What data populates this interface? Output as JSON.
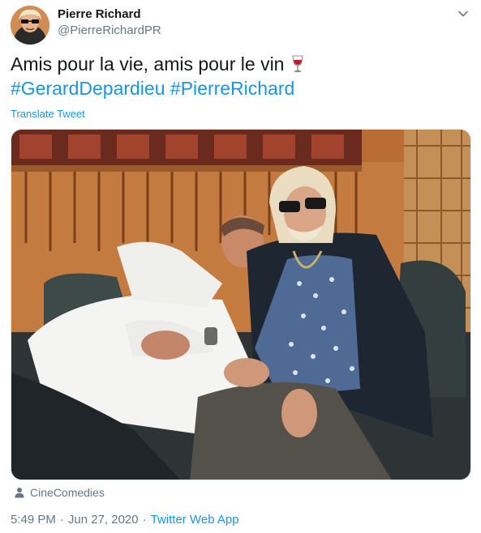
{
  "tweet": {
    "display_name": "Pierre Richard",
    "handle": "@PierreRichardPR",
    "text_line1": "Amis pour la vie, amis pour le vin",
    "emoji": "wine-glass",
    "hashtag1": "#GerardDepardieu",
    "hashtag2": "#PierreRichard",
    "translate_label": "Translate Tweet",
    "media_tag": "CineComedies",
    "time": "5:49 PM",
    "separator": "·",
    "date": "Jun 27, 2020",
    "source": "Twitter Web App"
  },
  "colors": {
    "link": "#1b95e0",
    "secondary_text": "#657786",
    "primary_text": "#14171a"
  },
  "icons": {
    "caret": "chevron-down-icon",
    "media_tag": "person-icon",
    "emoji": "wine-glass-icon"
  }
}
